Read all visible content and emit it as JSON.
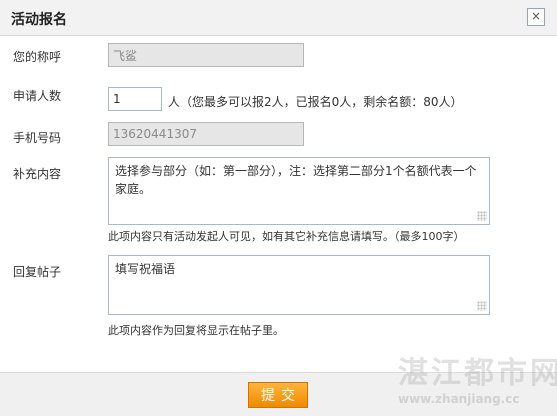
{
  "dialog": {
    "title": "活动报名",
    "close_label": "×"
  },
  "form": {
    "nickname": {
      "label": "您的称呼",
      "value": "飞鲨"
    },
    "applicants": {
      "label": "申请人数",
      "value": "1",
      "hint": "人（您最多可以报2人，已报名0人，剩余名额：80人）"
    },
    "phone": {
      "label": "手机号码",
      "value": "13620441307"
    },
    "extra": {
      "label": "补充内容",
      "value": "选择参与部分（如：第一部分），注：选择第二部分1个名额代表一个家庭。",
      "hint": "此项内容只有活动发起人可见，如有其它补充信息请填写。（最多100字）"
    },
    "reply": {
      "label": "回复帖子",
      "value": "填写祝福语",
      "hint": "此项内容作为回复将显示在帖子里。"
    }
  },
  "footer": {
    "submit_label": "提交"
  },
  "watermark": {
    "text": "湛江都市网",
    "url": "www.zhanjiang.cc"
  }
}
